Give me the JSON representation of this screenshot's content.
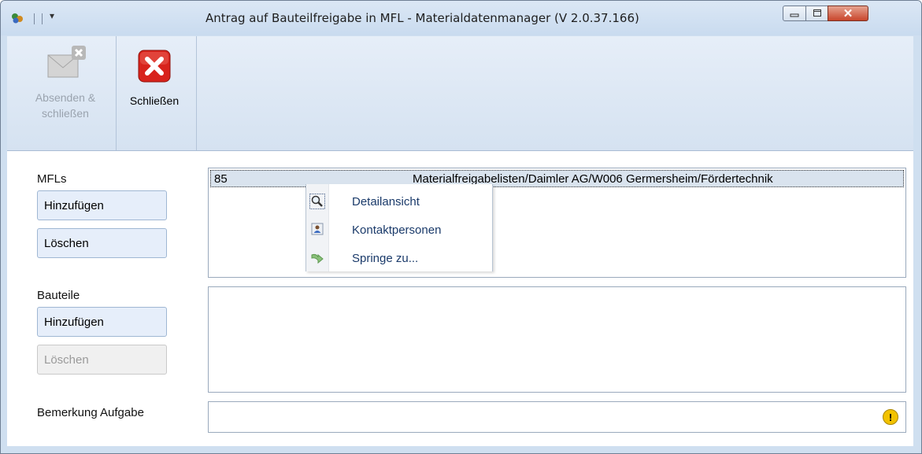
{
  "window": {
    "title": "Antrag auf Bauteilfreigabe in MFL - Materialdatenmanager (V 2.0.37.166)"
  },
  "ribbon": {
    "send_close_label": "Absenden & schließen",
    "close_label": "Schließen"
  },
  "mfls": {
    "label": "MFLs",
    "add_label": "Hinzufügen",
    "delete_label": "Löschen",
    "rows": [
      {
        "id": "85",
        "path": "Materialfreigabelisten/Daimler AG/W006 Germersheim/Fördertechnik"
      }
    ]
  },
  "context_menu": {
    "items": [
      {
        "label": "Detailansicht",
        "icon": "magnifier-icon"
      },
      {
        "label": "Kontaktpersonen",
        "icon": "contact-person-icon"
      },
      {
        "label": "Springe zu...",
        "icon": "jump-arrow-icon"
      }
    ]
  },
  "bauteile": {
    "label": "Bauteile",
    "add_label": "Hinzufügen",
    "delete_label": "Löschen"
  },
  "remark": {
    "label": "Bemerkung Aufgabe",
    "value": "",
    "warning_icon": "warning-icon",
    "warning_color": "#f2c200"
  },
  "colors": {
    "close_red": "#d8231c",
    "accent_blue": "#1a3a6a"
  }
}
